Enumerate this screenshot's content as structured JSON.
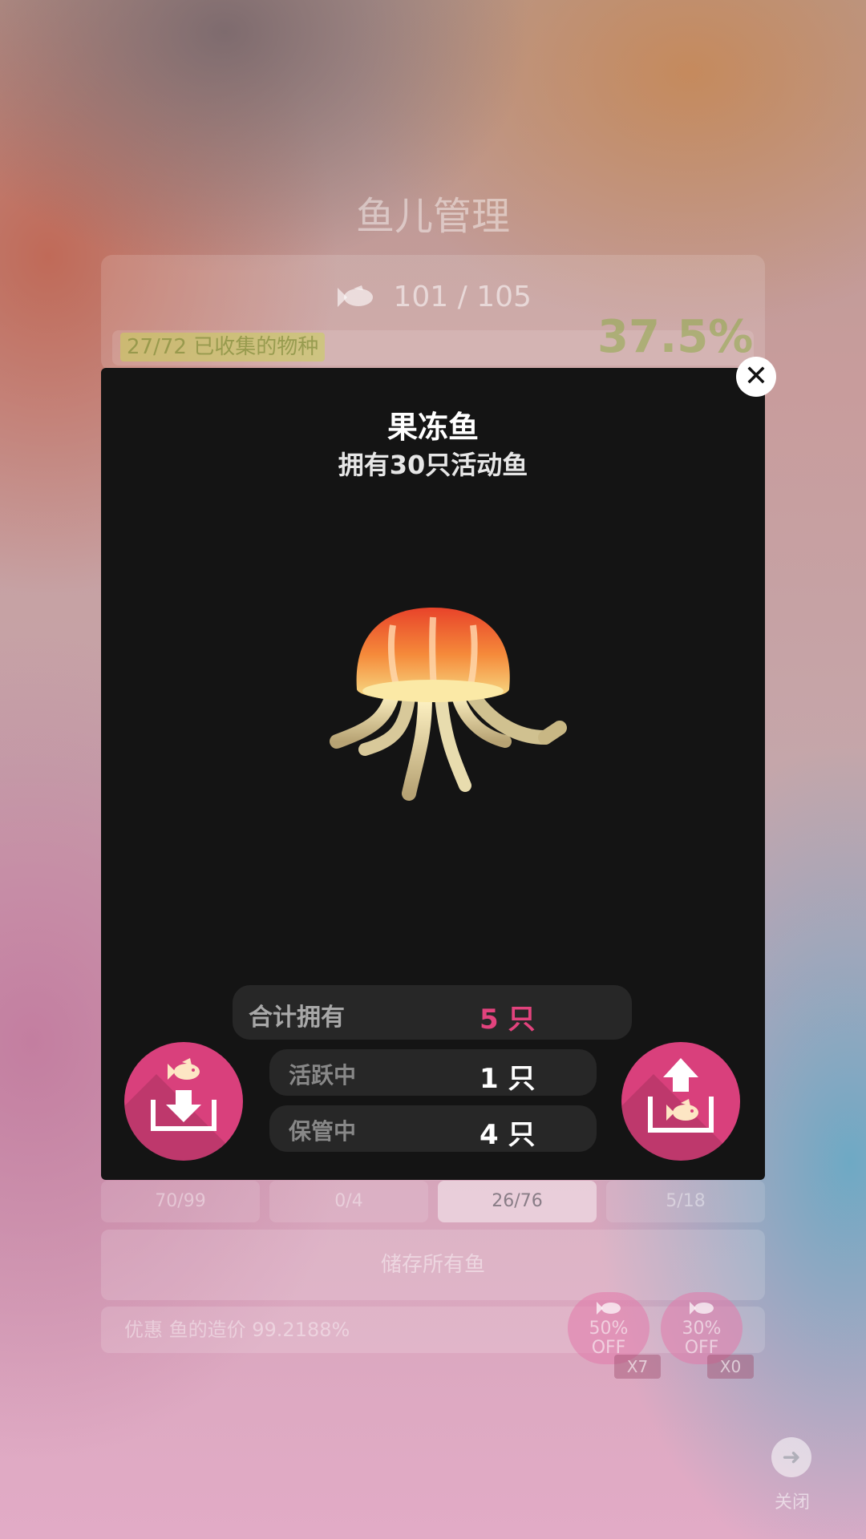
{
  "background": {
    "title": "鱼儿管理",
    "fish_count": "101 / 105",
    "species_collected": "27/72 已收集的物种",
    "percent": "37.5%",
    "tabs": [
      "70/99",
      "0/4",
      "26/76",
      "5/18"
    ],
    "active_tab_index": 2,
    "store_all_label": "储存所有鱼",
    "discount_text": "优惠 鱼的造价 99.2188%",
    "coupons": [
      {
        "label_line1": "50%",
        "label_line2": "OFF",
        "multiplier": "X7"
      },
      {
        "label_line1": "30%",
        "label_line2": "OFF",
        "multiplier": "X0"
      }
    ],
    "close_label": "关闭"
  },
  "modal": {
    "title": "果冻鱼",
    "subtitle": "拥有30只活动鱼",
    "stats": {
      "total_label": "合计拥有",
      "total_value": "5 只",
      "active_label": "活跃中",
      "active_value": "1 只",
      "stored_label": "保管中",
      "stored_value": "4 只"
    },
    "left_button": "store-fish",
    "right_button": "release-fish"
  },
  "colors": {
    "accent_pink": "#d9407c",
    "total_value": "#e2437d",
    "modal_bg": "#141414"
  }
}
